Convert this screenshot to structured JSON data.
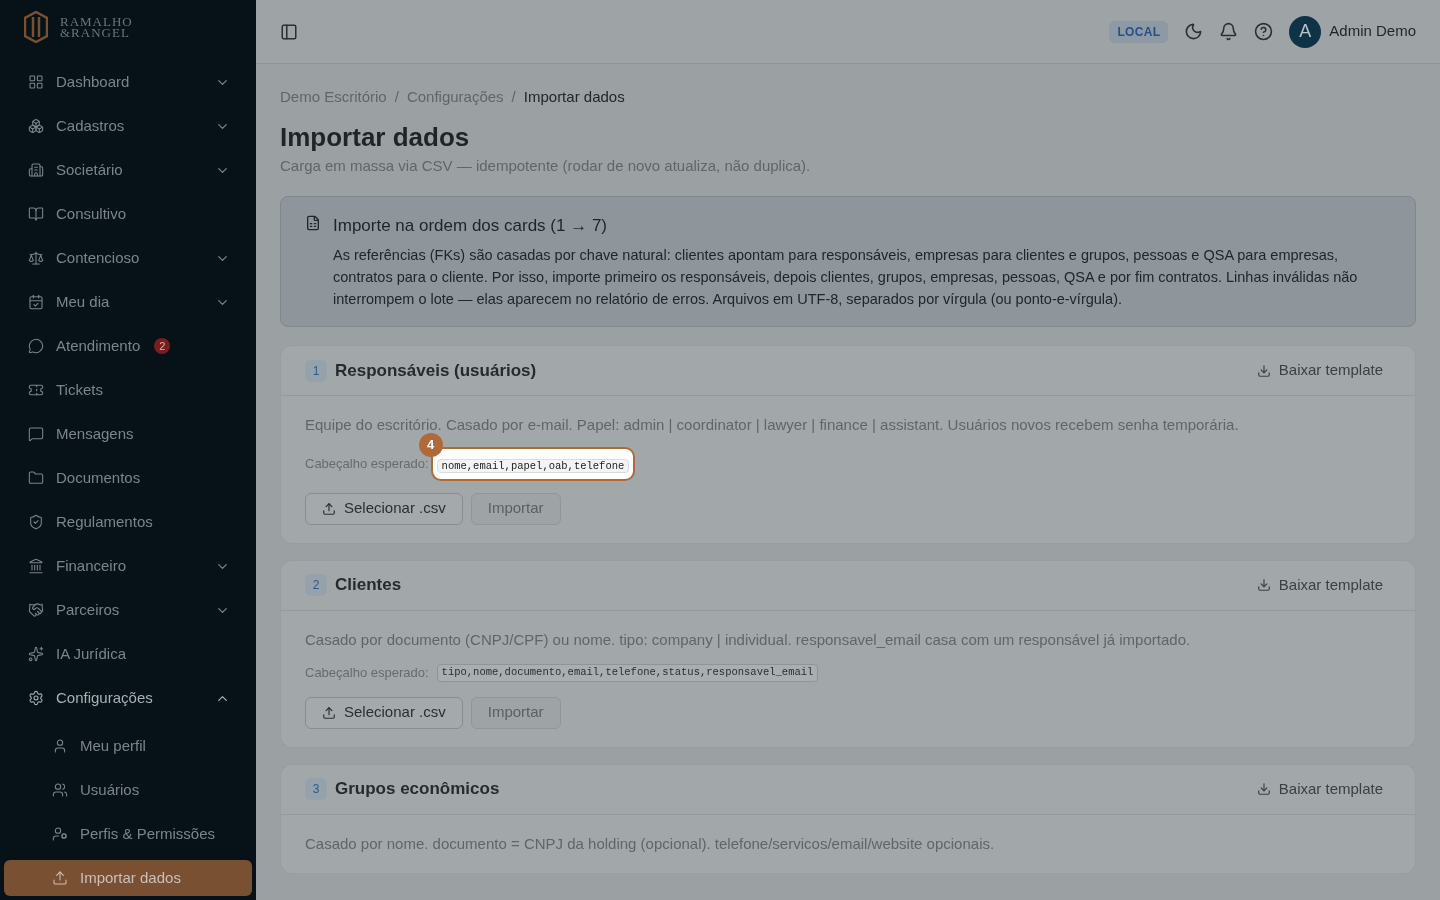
{
  "sidebar": {
    "logo": {
      "line1": "RAMALHO",
      "line2": "&RANGEL"
    },
    "items": [
      {
        "label": "Dashboard",
        "expandable": true,
        "expanded": false
      },
      {
        "label": "Cadastros",
        "expandable": true,
        "expanded": false
      },
      {
        "label": "Societário",
        "expandable": true,
        "expanded": false
      },
      {
        "label": "Consultivo",
        "expandable": false
      },
      {
        "label": "Contencioso",
        "expandable": true,
        "expanded": false
      },
      {
        "label": "Meu dia",
        "expandable": true,
        "expanded": false
      },
      {
        "label": "Atendimento",
        "expandable": false,
        "badge": "2"
      },
      {
        "label": "Tickets",
        "expandable": false
      },
      {
        "label": "Mensagens",
        "expandable": false
      },
      {
        "label": "Documentos",
        "expandable": false
      },
      {
        "label": "Regulamentos",
        "expandable": false
      },
      {
        "label": "Financeiro",
        "expandable": true,
        "expanded": false
      },
      {
        "label": "Parceiros",
        "expandable": true,
        "expanded": false
      },
      {
        "label": "IA Jurídica",
        "expandable": false
      },
      {
        "label": "Configurações",
        "expandable": true,
        "expanded": true,
        "children": [
          {
            "label": "Meu perfil",
            "selected": false
          },
          {
            "label": "Usuários",
            "selected": false
          },
          {
            "label": "Perfis & Permissões",
            "selected": false
          },
          {
            "label": "Importar dados",
            "selected": true
          }
        ]
      }
    ]
  },
  "header": {
    "env_badge": "LOCAL",
    "avatar_letter": "A",
    "user_name": "Admin Demo"
  },
  "breadcrumbs": [
    "Demo Escritório",
    "Configurações",
    "Importar dados"
  ],
  "breadcrumb_separator": "/",
  "title": "Importar dados",
  "subtitle": "Carga em massa via CSV — idempotente (rodar de novo atualiza, não duplica).",
  "info": {
    "title": "Importe na ordem dos cards (1 → 7)",
    "text": "As referências (FKs) são casadas por chave natural: clientes apontam para responsáveis, empresas para clientes e grupos, pessoas e QSA para empresas, contratos para o cliente. Por isso, importe primeiro os responsáveis, depois clientes, grupos, empresas, pessoas, QSA e por fim contratos. Linhas inválidas não interrompem o lote — elas aparecem no relatório de erros. Arquivos em UTF-8, separados por vírgula (ou ponto-e-vírgula)."
  },
  "tour_step": "4",
  "cards": [
    {
      "number": "1",
      "title": "Responsáveis (usuários)",
      "download": "Baixar template",
      "description": "Equipe do escritório. Casado por e-mail. Papel: admin | coordinator | lawyer | finance | assistant. Usuários novos recebem senha temporária.",
      "header_label": "Cabeçalho esperado:",
      "header_code": "nome,email,papel,oab,telefone",
      "highlighted": true,
      "select_button": "Selecionar .csv",
      "import_button": "Importar",
      "import_disabled": true
    },
    {
      "number": "2",
      "title": "Clientes",
      "download": "Baixar template",
      "description": "Casado por documento (CNPJ/CPF) ou nome. tipo: company | individual. responsavel_email casa com um responsável já importado.",
      "header_label": "Cabeçalho esperado:",
      "header_code": "tipo,nome,documento,email,telefone,status,responsavel_email",
      "highlighted": false,
      "select_button": "Selecionar .csv",
      "import_button": "Importar",
      "import_disabled": true
    },
    {
      "number": "3",
      "title": "Grupos econômicos",
      "download": "Baixar template",
      "description": "Casado por nome. documento = CNPJ da holding (opcional). telefone/servicos/email/website opcionais."
    }
  ]
}
